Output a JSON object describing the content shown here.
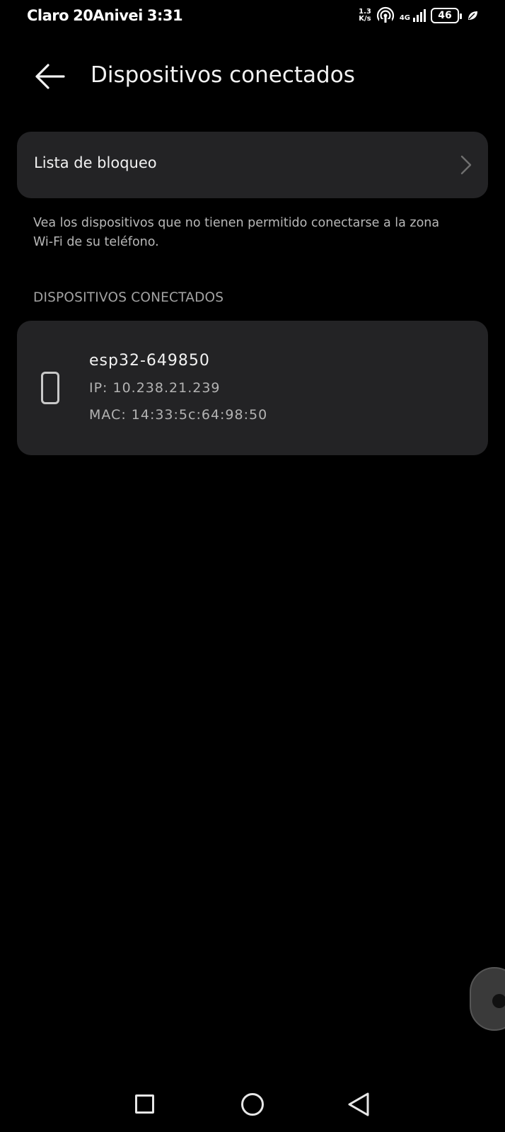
{
  "status_bar": {
    "carrier": "Claro",
    "carrier_extra": "20Anivei",
    "time": "3:31",
    "net_speed_value": "1.3",
    "net_speed_unit": "K/s",
    "network_type": "4G",
    "battery_level": "46",
    "icons": [
      "hotspot-icon",
      "signal-icon",
      "battery-icon",
      "leaf-icon"
    ]
  },
  "header": {
    "title": "Dispositivos conectados",
    "back_icon": "arrow-left-icon"
  },
  "block_list": {
    "label": "Lista de bloqueo",
    "icon": "chevron-right-icon",
    "description": "Vea los dispositivos que no tienen permitido conectarse a la zona Wi-Fi de su teléfono."
  },
  "connected": {
    "section_title": "DISPOSITIVOS CONECTADOS",
    "devices": [
      {
        "name": "esp32-649850",
        "ip": "IP: 10.238.21.239",
        "mac": "MAC: 14:33:5c:64:98:50",
        "icon": "phone-icon"
      }
    ]
  },
  "nav_bar": {
    "icons": [
      "recents-icon",
      "home-icon",
      "back-icon"
    ]
  },
  "colors": {
    "background": "#000000",
    "card": "#232325",
    "text_primary": "#f2f2f2",
    "text_secondary": "#b3b3b3"
  }
}
